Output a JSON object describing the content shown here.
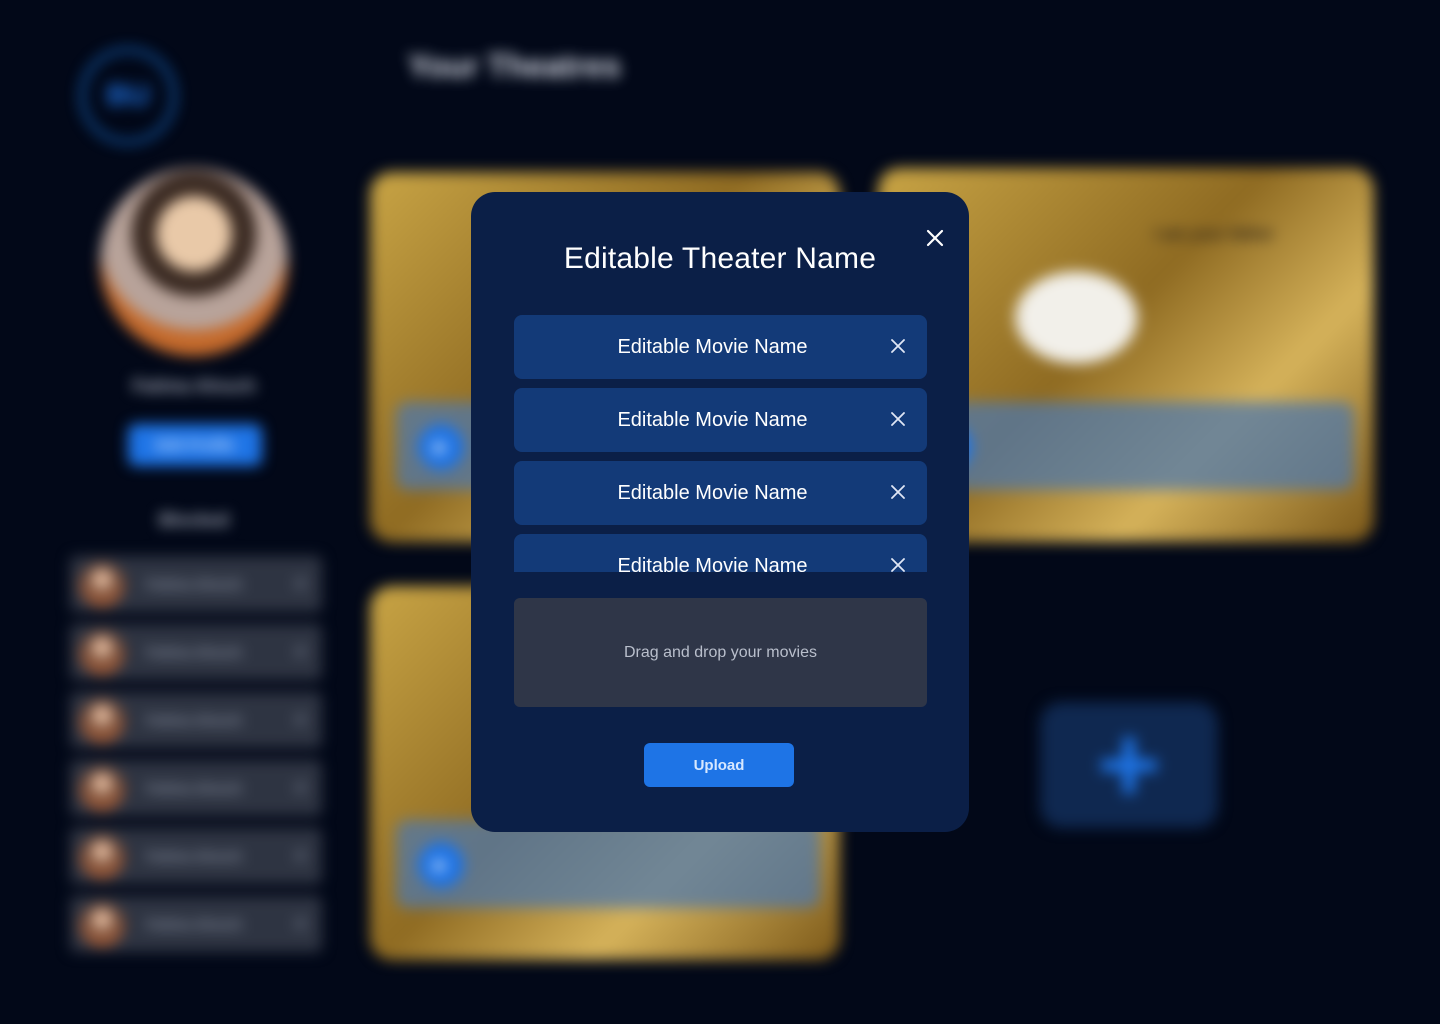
{
  "colors": {
    "page_background": "#020818",
    "modal_background": "#0b1f47",
    "movie_row": "#133a78",
    "dropzone": "#2f3648",
    "accent": "#1e74e6"
  },
  "background": {
    "logo": {
      "text": "BU"
    },
    "page_heading": "Your Theatres",
    "profile": {
      "name": "Fatima Alnuch",
      "edit_button_label": "Edit Profile"
    },
    "blocked": {
      "title": "Blocked",
      "items": [
        {
          "name": "Fatima Alnuch",
          "remove_icon": "close-icon"
        },
        {
          "name": "Fatima Alnuch",
          "remove_icon": "close-icon"
        },
        {
          "name": "Fatima Alnuch",
          "remove_icon": "close-icon"
        },
        {
          "name": "Fatima Alnuch",
          "remove_icon": "close-icon"
        },
        {
          "name": "Fatima Alnuch",
          "remove_icon": "close-icon"
        },
        {
          "name": "Fatima Alnuch",
          "remove_icon": "close-icon"
        }
      ]
    },
    "theatres": [
      {
        "caption": "",
        "play_icon": "play-icon"
      },
      {
        "caption": "",
        "quote": "I am your father",
        "play_icon": "play-icon"
      },
      {
        "caption": "",
        "play_icon": "play-icon"
      }
    ],
    "add_theatre_icon": "plus-icon"
  },
  "modal": {
    "title": "Editable Theater Name",
    "close_icon": "close-icon",
    "movies": [
      {
        "name": "Editable Movie Name",
        "remove_icon": "close-icon"
      },
      {
        "name": "Editable Movie Name",
        "remove_icon": "close-icon"
      },
      {
        "name": "Editable Movie Name",
        "remove_icon": "close-icon"
      },
      {
        "name": "Editable Movie Name",
        "remove_icon": "close-icon"
      }
    ],
    "dropzone_text": "Drag and drop your movies",
    "upload_label": "Upload"
  }
}
